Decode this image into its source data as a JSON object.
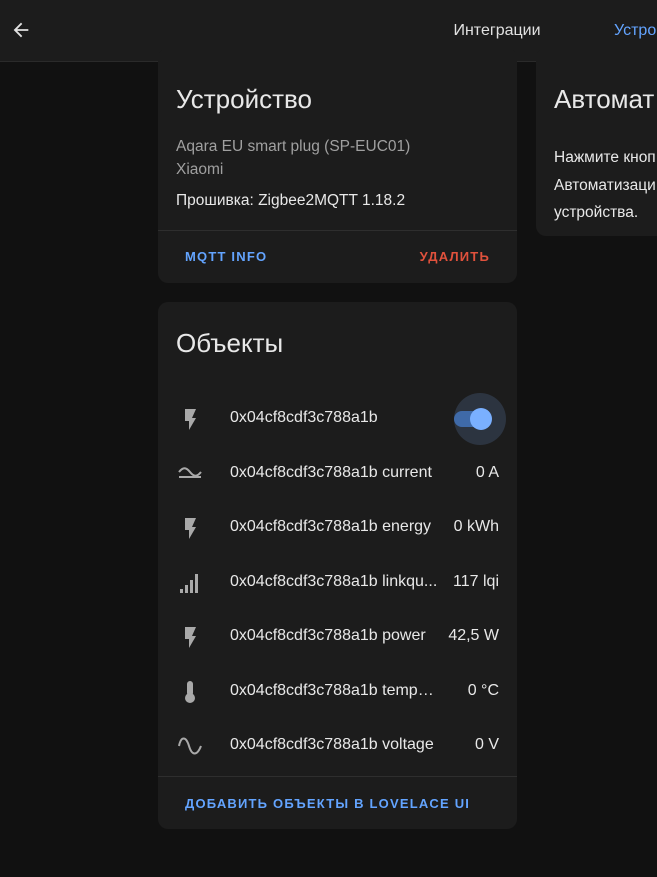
{
  "header": {
    "back_icon": "arrow-left-icon",
    "tabs": [
      {
        "label": "Интеграции"
      },
      {
        "label": "Устро"
      }
    ],
    "accent": "#63a4ff"
  },
  "device_card": {
    "title": "Устройство",
    "model": "Aqara EU smart plug (SP-EUC01)",
    "manufacturer": "Xiaomi",
    "firmware": "Прошивка: Zigbee2MQTT 1.18.2",
    "mqtt_button": "MQTT INFO",
    "delete_button": "УДАЛИТЬ"
  },
  "automation_card": {
    "title": "Автомат",
    "lines": [
      "Нажмите кноп",
      "Автоматизаци",
      "устройства."
    ]
  },
  "objects_card": {
    "title": "Объекты",
    "entities": [
      {
        "icon": "flash-icon",
        "name": "0x04cf8cdf3c788a1b",
        "value": "",
        "toggle": true,
        "toggle_state": "on"
      },
      {
        "icon": "current-ac-icon",
        "name": "0x04cf8cdf3c788a1b current",
        "value": "0 A"
      },
      {
        "icon": "flash-icon",
        "name": "0x04cf8cdf3c788a1b energy",
        "value": "0 kWh"
      },
      {
        "icon": "signal-bars-icon",
        "name": "0x04cf8cdf3c788a1b linkqu...",
        "value": "117 lqi"
      },
      {
        "icon": "flash-icon",
        "name": "0x04cf8cdf3c788a1b power",
        "value": "42,5 W"
      },
      {
        "icon": "thermometer-icon",
        "name": "0x04cf8cdf3c788a1b temperat...",
        "value": "0 °C"
      },
      {
        "icon": "sine-wave-icon",
        "name": "0x04cf8cdf3c788a1b voltage",
        "value": "0 V"
      }
    ],
    "add_button": "ДОБАВИТЬ ОБЪЕКТЫ В LOVELACE UI"
  }
}
